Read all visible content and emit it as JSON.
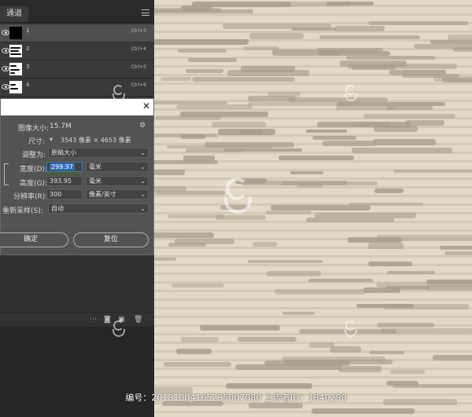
{
  "panel": {
    "tab_label": "通道"
  },
  "channels": [
    {
      "num": "1",
      "shortcut": "Ctrl+3"
    },
    {
      "num": "2",
      "shortcut": "Ctrl+4"
    },
    {
      "num": "3",
      "shortcut": "Ctrl+5"
    },
    {
      "num": "4",
      "shortcut": "Ctrl+6"
    }
  ],
  "dialog": {
    "image_size_label": "图像大小:",
    "image_size_value": "15.7M",
    "dimensions_label": "尺寸:",
    "dimensions_value": "3543 像素 × 4653 像素",
    "fit_label": "调整为:",
    "fit_value": "原稿大小",
    "width_label": "宽度(D):",
    "width_value": "299.97",
    "width_unit": "毫米",
    "height_label": "高度(G):",
    "height_value": "393.95",
    "height_unit": "毫米",
    "resolution_label": "分辨率(R):",
    "resolution_value": "300",
    "resolution_unit": "像素/英寸",
    "resample_label": "重新采样(S):",
    "resample_value": "自动",
    "ok_label": "确定",
    "reset_label": "复位"
  },
  "footer_text": "编号：20181004165235007080 上传者ID：1840290",
  "colors": {
    "canvas_bg": "#e3d9c6",
    "stroke": "#a79e8d",
    "panel": "#323232",
    "dialog": "#535353",
    "accent": "#2f80d0"
  }
}
